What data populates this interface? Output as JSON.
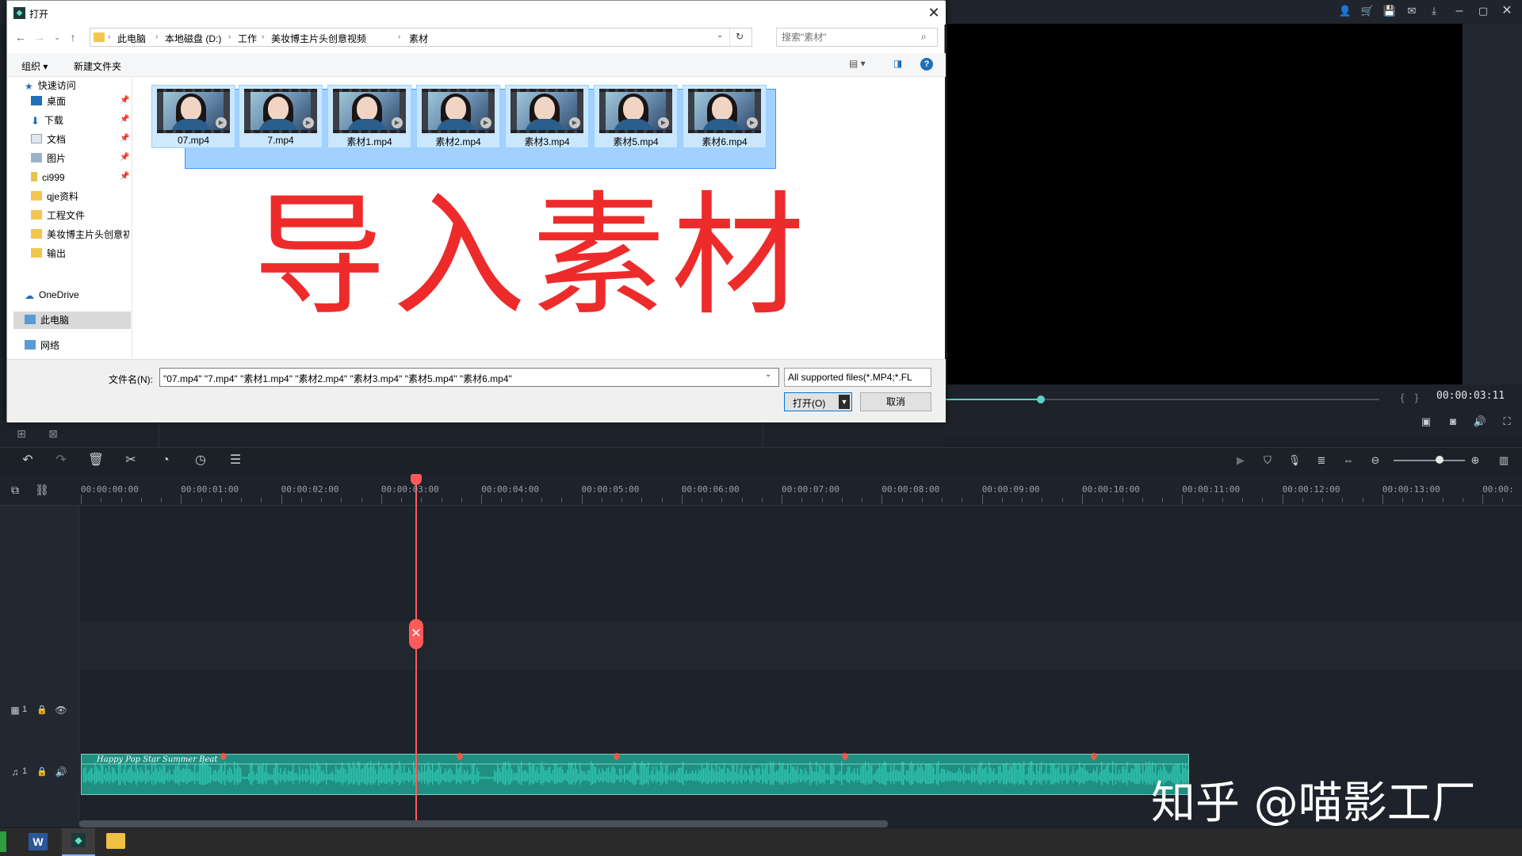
{
  "dialog": {
    "title": "打开",
    "close_glyph": "✕",
    "breadcrumbs": [
      "此电脑",
      "本地磁盘 (D:)",
      "工作",
      "美妆博主片头创意视频",
      "素材"
    ],
    "search_placeholder": "搜索\"素材\"",
    "cmd": {
      "organize": "组织 ▾",
      "new_folder": "新建文件夹"
    },
    "nav": [
      {
        "label": "快速访问",
        "pinned": false
      },
      {
        "label": "桌面",
        "pinned": true
      },
      {
        "label": "下载",
        "pinned": true
      },
      {
        "label": "文档",
        "pinned": true
      },
      {
        "label": "图片",
        "pinned": true
      },
      {
        "label": "ci999",
        "pinned": true
      },
      {
        "label": "qje资料",
        "pinned": false
      },
      {
        "label": "工程文件",
        "pinned": false
      },
      {
        "label": "美妆博主片头创意初",
        "pinned": false
      },
      {
        "label": "输出",
        "pinned": false
      },
      {
        "label": "OneDrive",
        "pinned": false
      },
      {
        "label": "此电脑",
        "pinned": false
      },
      {
        "label": "网络",
        "pinned": false
      }
    ],
    "files": [
      "07.mp4",
      "7.mp4",
      "素材1.mp4",
      "素材2.mp4",
      "素材3.mp4",
      "素材5.mp4",
      "素材6.mp4"
    ],
    "overlay_text": "导入素材",
    "filename_label": "文件名(N):",
    "filename_value": "\"07.mp4\" \"7.mp4\" \"素材1.mp4\" \"素材2.mp4\" \"素材3.mp4\" \"素材5.mp4\" \"素材6.mp4\"",
    "filter_value": "All supported files(*.MP4;*.FL",
    "open_label": "打开(O)",
    "cancel_label": "取消"
  },
  "editor": {
    "timecode": "00:00:03:11",
    "ruler_ticks": [
      "00:00:00:00",
      "00:00:01:00",
      "00:00:02:00",
      "00:00:03:00",
      "00:00:04:00",
      "00:00:05:00",
      "00:00:06:00",
      "00:00:07:00",
      "00:00:08:00",
      "00:00:09:00",
      "00:00:10:00",
      "00:00:11:00",
      "00:00:12:00",
      "00:00:13:00",
      "00:00:"
    ],
    "video_track_label": "1",
    "audio_track_label": "1",
    "audio_clip_title": "Happy Pop Star Summer Beat",
    "playback_progress_pct": 22,
    "zoom_level_pct": 64
  },
  "watermark": "知乎 @喵影工厂",
  "colors": {
    "accent": "#5fd0c4",
    "playhead": "#ff5a5a",
    "overlay": "#ee2b2b",
    "selection": "#3399ff"
  }
}
